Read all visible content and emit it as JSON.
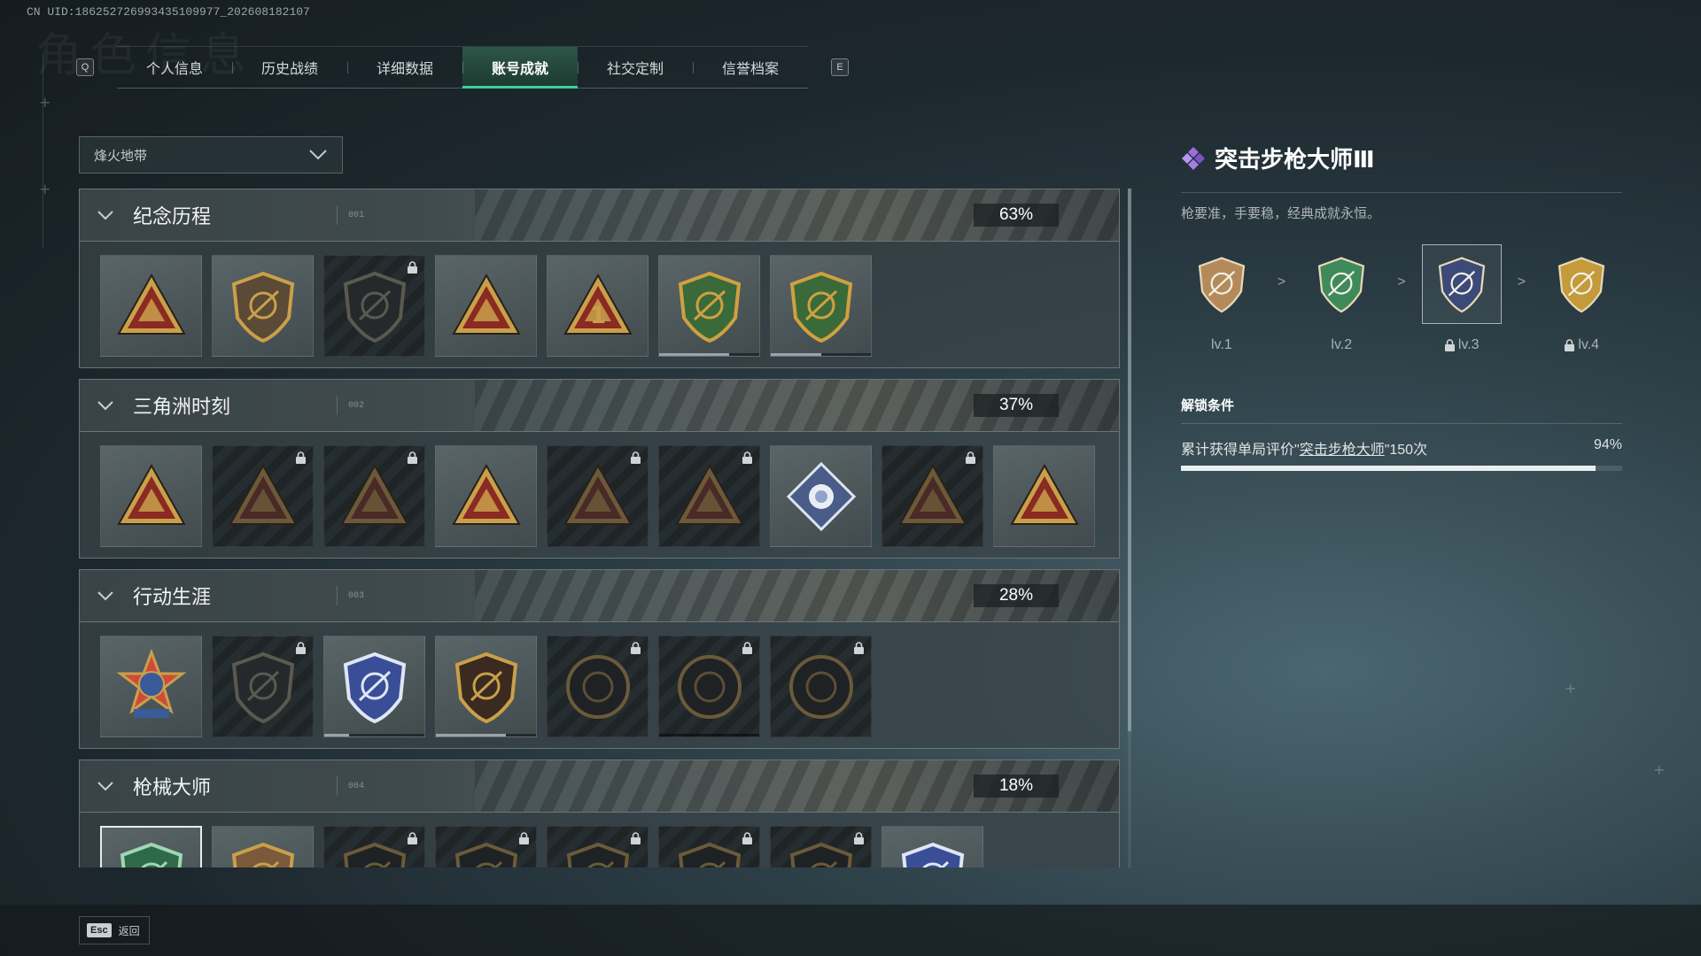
{
  "uid": "CN UID:18625272699343510997​7_202608182107",
  "tabs": {
    "left_key": "Q",
    "right_key": "E",
    "items": [
      {
        "label": "个人信息"
      },
      {
        "label": "历史战绩"
      },
      {
        "label": "详细数据"
      },
      {
        "label": "账号成就",
        "active": true
      },
      {
        "label": "社交定制"
      },
      {
        "label": "信誉档案"
      }
    ]
  },
  "filter": {
    "selected": "烽火地带"
  },
  "sections": [
    {
      "title": "纪念历程",
      "num": "001",
      "percent": "63%",
      "badges": [
        {
          "icon": "triangle-emblem-icon",
          "locked": false
        },
        {
          "icon": "helicopter-emblem-icon",
          "locked": false
        },
        {
          "icon": "dark-shield-emblem-icon",
          "locked": true
        },
        {
          "icon": "triangle-wave-emblem-icon",
          "locked": false
        },
        {
          "icon": "triangle-number-one-icon",
          "locked": false
        },
        {
          "icon": "delta-force-anniversary-icon",
          "locked": false,
          "progress": 0.7
        },
        {
          "icon": "delta-force-2026-icon",
          "locked": false,
          "progress": 0.5
        }
      ]
    },
    {
      "title": "三角洲时刻",
      "num": "002",
      "percent": "37%",
      "badges": [
        {
          "icon": "triangle-box-emblem-icon",
          "locked": false
        },
        {
          "icon": "triangle-soldier-emblem-icon",
          "locked": true
        },
        {
          "icon": "triangle-star-emblem-icon",
          "locked": true
        },
        {
          "icon": "triangle-squad-emblem-icon",
          "locked": false
        },
        {
          "icon": "triangle-beast-emblem-icon",
          "locked": true
        },
        {
          "icon": "triangle-dragon-emblem-icon",
          "locked": true
        },
        {
          "icon": "diamond-rose-emblem-icon",
          "locked": false
        },
        {
          "icon": "triangle-snake-emblem-icon",
          "locked": true
        },
        {
          "icon": "triangle-diver-emblem-icon",
          "locked": false
        }
      ]
    },
    {
      "title": "行动生涯",
      "num": "003",
      "percent": "28%",
      "badges": [
        {
          "icon": "star-medal-emblem-icon",
          "locked": false
        },
        {
          "icon": "dark-crest-emblem-icon",
          "locked": true
        },
        {
          "icon": "blue-police-shield-icon",
          "locked": false,
          "progress": 0.25
        },
        {
          "icon": "gem-shield-emblem-icon",
          "locked": false,
          "progress": 0.7
        },
        {
          "icon": "round-helmet-emblem-icon",
          "locked": true
        },
        {
          "icon": "round-skull-emblem-icon",
          "locked": true,
          "progress": 0.0
        },
        {
          "icon": "round-eye-emblem-icon",
          "locked": true
        }
      ]
    },
    {
      "title": "枪械大师",
      "num": "004",
      "percent": "18%",
      "badges": [
        {
          "icon": "green-rifle-shield-icon",
          "locked": false,
          "selected": true
        },
        {
          "icon": "bronze-rifle-shield-icon",
          "locked": false
        },
        {
          "icon": "locked-rifle-shield-icon",
          "locked": true
        },
        {
          "icon": "locked-rifle-shield-icon",
          "locked": true
        },
        {
          "icon": "locked-rifle-shield-icon",
          "locked": true
        },
        {
          "icon": "locked-rifle-shield-icon",
          "locked": true
        },
        {
          "icon": "locked-rifle-shield-icon",
          "locked": true
        },
        {
          "icon": "blue-rifle-shield-icon",
          "locked": false
        }
      ]
    }
  ],
  "detail": {
    "title": "突击步枪大师Ⅲ",
    "description": "枪要准，手要稳，经典成就永恒。",
    "levels": [
      {
        "label": "lv.1",
        "locked": false,
        "color": "#b58a5a"
      },
      {
        "label": "lv.2",
        "locked": false,
        "color": "#3f8a5a"
      },
      {
        "label": "lv.3",
        "locked": true,
        "selected": true,
        "color": "#3b4a78"
      },
      {
        "label": "lv.4",
        "locked": true,
        "color": "#c49a3a"
      }
    ],
    "arrow": ">",
    "condition_title": "解锁条件",
    "condition_prefix": "累计获得单局评价\"",
    "condition_link": "突击步枪大师",
    "condition_suffix": "\"150次",
    "condition_percent": "94%",
    "condition_progress": 0.94
  },
  "footer": {
    "key": "Esc",
    "label": "返回"
  },
  "colors": {
    "accent": "#3fd19a",
    "gold": "#c9a04a",
    "bg": "#1d282e"
  }
}
